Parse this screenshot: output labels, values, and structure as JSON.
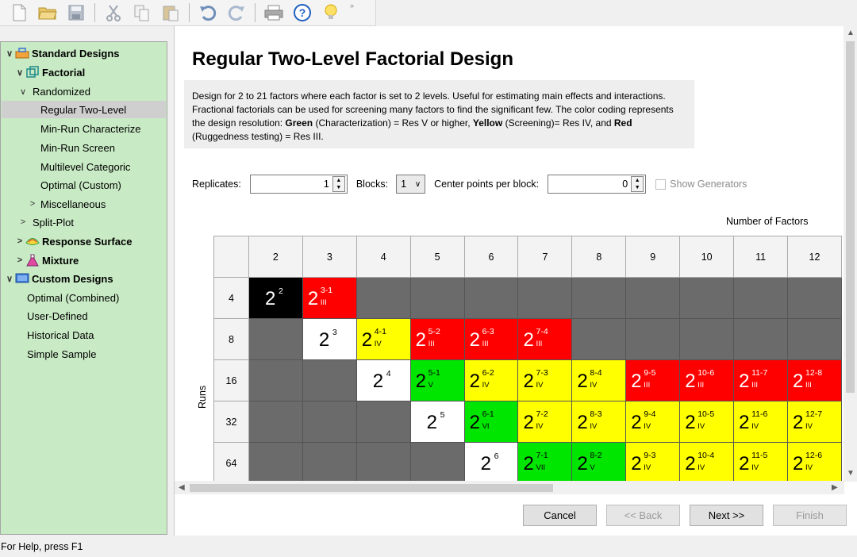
{
  "toolbar": {
    "icons": [
      "new-file-icon",
      "open-folder-icon",
      "save-icon",
      "cut-icon",
      "copy-icon",
      "paste-icon",
      "undo-icon",
      "redo-icon",
      "print-icon",
      "help-icon",
      "tip-bulb-icon"
    ]
  },
  "tree": {
    "items": [
      {
        "label": "Standard Designs",
        "chev": "∨",
        "icon": "toolbox-icon"
      },
      {
        "label": "Factorial",
        "chev": "∨",
        "icon": "factorial-cube-icon"
      },
      {
        "label": "Randomized",
        "chev": "∨"
      },
      {
        "label": "Regular Two-Level"
      },
      {
        "label": "Min-Run Characterize"
      },
      {
        "label": "Min-Run Screen"
      },
      {
        "label": "Multilevel Categoric"
      },
      {
        "label": "Optimal (Custom)"
      },
      {
        "label": "Miscellaneous",
        "chev": ">"
      },
      {
        "label": "Split-Plot",
        "chev": ">"
      },
      {
        "label": "Response Surface",
        "chev": ">",
        "icon": "response-surface-icon"
      },
      {
        "label": "Mixture",
        "chev": ">",
        "icon": "mixture-flask-icon"
      },
      {
        "label": "Custom Designs",
        "chev": "∨",
        "icon": "custom-designs-icon"
      },
      {
        "label": "Optimal (Combined)"
      },
      {
        "label": "User-Defined"
      },
      {
        "label": "Historical Data"
      },
      {
        "label": "Simple Sample"
      }
    ]
  },
  "main": {
    "title": "Regular Two-Level Factorial Design",
    "description": {
      "p1": "Design for 2 to 21 factors where each factor is set to 2 levels. Useful for estimating main effects and interactions. Fractional factorials can be used for screening many factors to find the significant few. The color coding represents the design resolution: ",
      "green": "Green",
      "p2": " (Characterization) = Res V or higher, ",
      "yellow": "Yellow",
      "p3": " (Screening)= Res IV, and ",
      "red": "Red",
      "p4": " (Ruggedness testing) = Res III."
    },
    "replicates_label": "Replicates:",
    "replicates_value": "1",
    "blocks_label": "Blocks:",
    "blocks_value": "1",
    "center_label": "Center points per block:",
    "center_value": "0",
    "show_generators": "Show Generators",
    "number_of_factors": "Number of Factors",
    "runs_label": "Runs"
  },
  "grid": {
    "factors": [
      "2",
      "3",
      "4",
      "5",
      "6",
      "7",
      "8",
      "9",
      "10",
      "11",
      "12"
    ],
    "runs": [
      "4",
      "8",
      "16",
      "32",
      "64"
    ],
    "rows": [
      [
        {
          "c": "black",
          "e": "2"
        },
        {
          "c": "red",
          "e": "3-1",
          "r": "III"
        },
        {
          "c": "gray"
        },
        {
          "c": "gray"
        },
        {
          "c": "gray"
        },
        {
          "c": "gray"
        },
        {
          "c": "gray"
        },
        {
          "c": "gray"
        },
        {
          "c": "gray"
        },
        {
          "c": "gray"
        },
        {
          "c": "gray"
        }
      ],
      [
        {
          "c": "gray"
        },
        {
          "c": "white",
          "e": "3"
        },
        {
          "c": "yellow",
          "e": "4-1",
          "r": "IV"
        },
        {
          "c": "red",
          "e": "5-2",
          "r": "III"
        },
        {
          "c": "red",
          "e": "6-3",
          "r": "III"
        },
        {
          "c": "red",
          "e": "7-4",
          "r": "III"
        },
        {
          "c": "gray"
        },
        {
          "c": "gray"
        },
        {
          "c": "gray"
        },
        {
          "c": "gray"
        },
        {
          "c": "gray"
        }
      ],
      [
        {
          "c": "gray"
        },
        {
          "c": "gray"
        },
        {
          "c": "white",
          "e": "4"
        },
        {
          "c": "green",
          "e": "5-1",
          "r": "V"
        },
        {
          "c": "yellow",
          "e": "6-2",
          "r": "IV"
        },
        {
          "c": "yellow",
          "e": "7-3",
          "r": "IV"
        },
        {
          "c": "yellow",
          "e": "8-4",
          "r": "IV"
        },
        {
          "c": "red",
          "e": "9-5",
          "r": "III"
        },
        {
          "c": "red",
          "e": "10-6",
          "r": "III"
        },
        {
          "c": "red",
          "e": "11-7",
          "r": "III"
        },
        {
          "c": "red",
          "e": "12-8",
          "r": "III"
        }
      ],
      [
        {
          "c": "gray"
        },
        {
          "c": "gray"
        },
        {
          "c": "gray"
        },
        {
          "c": "white",
          "e": "5"
        },
        {
          "c": "green",
          "e": "6-1",
          "r": "VI"
        },
        {
          "c": "yellow",
          "e": "7-2",
          "r": "IV"
        },
        {
          "c": "yellow",
          "e": "8-3",
          "r": "IV"
        },
        {
          "c": "yellow",
          "e": "9-4",
          "r": "IV"
        },
        {
          "c": "yellow",
          "e": "10-5",
          "r": "IV"
        },
        {
          "c": "yellow",
          "e": "11-6",
          "r": "IV"
        },
        {
          "c": "yellow",
          "e": "12-7",
          "r": "IV"
        }
      ],
      [
        {
          "c": "gray"
        },
        {
          "c": "gray"
        },
        {
          "c": "gray"
        },
        {
          "c": "gray"
        },
        {
          "c": "white",
          "e": "6"
        },
        {
          "c": "green",
          "e": "7-1",
          "r": "VII"
        },
        {
          "c": "green",
          "e": "8-2",
          "r": "V"
        },
        {
          "c": "yellow",
          "e": "9-3",
          "r": "IV"
        },
        {
          "c": "yellow",
          "e": "10-4",
          "r": "IV"
        },
        {
          "c": "yellow",
          "e": "11-5",
          "r": "IV"
        },
        {
          "c": "yellow",
          "e": "12-6",
          "r": "IV"
        }
      ]
    ]
  },
  "buttons": {
    "cancel": "Cancel",
    "back": "<< Back",
    "next": "Next >>",
    "finish": "Finish"
  },
  "status": {
    "text": "For Help, press F1"
  },
  "colors": {
    "tree_bg": "#c8eac4",
    "red": "#ff0000",
    "yellow": "#ffff00",
    "green": "#00e600",
    "gray": "#6b6b6b"
  }
}
